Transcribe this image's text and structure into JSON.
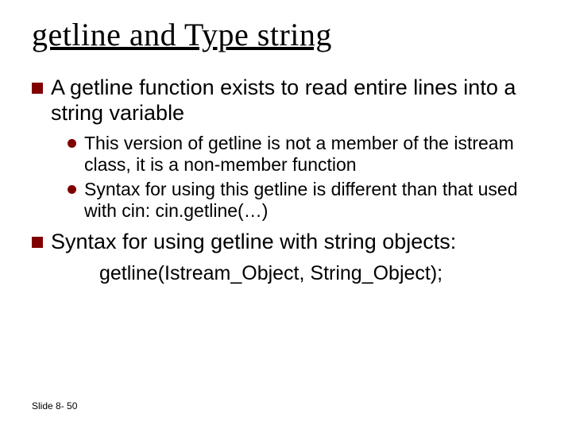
{
  "title": "getline and Type string",
  "bullets": {
    "l1a": "A getline function exists to read entire lines into a string variable",
    "l2a": "This version of getline is not a member of the istream class, it is a non-member function",
    "l2b": "Syntax for using this getline is different than that used with cin:  cin.getline(…)",
    "l1b": "Syntax for using getline with string objects:",
    "l3": "getline(Istream_Object, String_Object);"
  },
  "footer": "Slide 8- 50"
}
